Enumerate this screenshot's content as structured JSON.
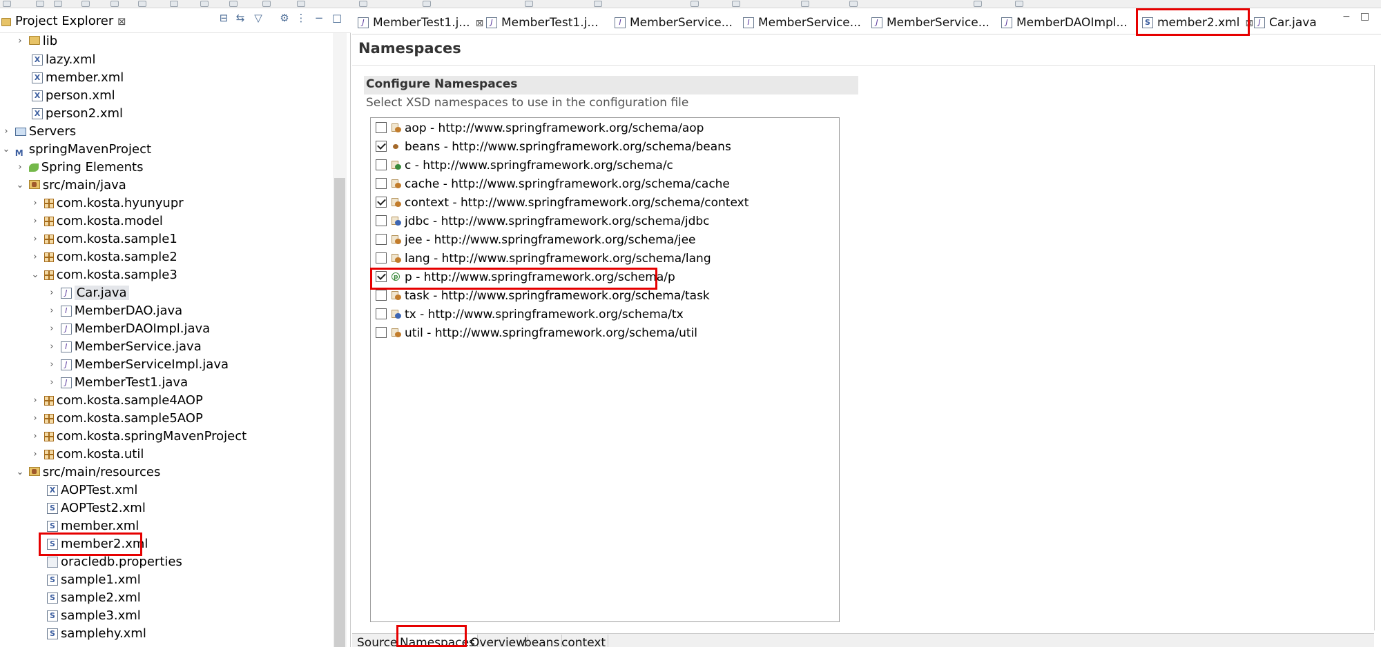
{
  "project_explorer": {
    "title": "Project Explorer",
    "close": "⊠",
    "tree": [
      {
        "label": "lib",
        "icon": "folder-icon",
        "chevron": "›"
      },
      {
        "label": "lazy.xml",
        "icon": "xml-file-icon"
      },
      {
        "label": "member.xml",
        "icon": "xml-file-icon"
      },
      {
        "label": "person.xml",
        "icon": "xml-file-icon"
      },
      {
        "label": "person2.xml",
        "icon": "xml-file-icon"
      },
      {
        "label": "Servers",
        "icon": "servers-folder-icon",
        "chevron": "›"
      },
      {
        "label": "springMavenProject",
        "icon": "maven-project-icon",
        "chevron": "⌄"
      },
      {
        "label": "Spring Elements",
        "icon": "spring-leaf-icon",
        "chevron": "›"
      },
      {
        "label": "src/main/java",
        "icon": "source-folder-icon",
        "chevron": "⌄"
      },
      {
        "label": "com.kosta.hyunyupr",
        "icon": "package-icon",
        "chevron": "›"
      },
      {
        "label": "com.kosta.model",
        "icon": "package-icon",
        "chevron": "›"
      },
      {
        "label": "com.kosta.sample1",
        "icon": "package-icon",
        "chevron": "›"
      },
      {
        "label": "com.kosta.sample2",
        "icon": "package-icon",
        "chevron": "›"
      },
      {
        "label": "com.kosta.sample3",
        "icon": "package-icon",
        "chevron": "⌄"
      },
      {
        "label": "Car.java",
        "icon": "java-file-icon",
        "chevron": "›"
      },
      {
        "label": "MemberDAO.java",
        "icon": "java-interface-icon",
        "chevron": "›"
      },
      {
        "label": "MemberDAOImpl.java",
        "icon": "java-spring-bean-icon",
        "chevron": "›"
      },
      {
        "label": "MemberService.java",
        "icon": "java-interface-icon",
        "chevron": "›"
      },
      {
        "label": "MemberServiceImpl.java",
        "icon": "java-spring-bean-icon",
        "chevron": "›"
      },
      {
        "label": "MemberTest1.java",
        "icon": "java-file-icon",
        "chevron": "›"
      },
      {
        "label": "com.kosta.sample4AOP",
        "icon": "package-icon",
        "chevron": "›"
      },
      {
        "label": "com.kosta.sample5AOP",
        "icon": "package-icon",
        "chevron": "›"
      },
      {
        "label": "com.kosta.springMavenProject",
        "icon": "package-icon",
        "chevron": "›"
      },
      {
        "label": "com.kosta.util",
        "icon": "package-icon",
        "chevron": "›"
      },
      {
        "label": "src/main/resources",
        "icon": "source-folder-icon",
        "chevron": "⌄"
      },
      {
        "label": "AOPTest.xml",
        "icon": "xml-file-icon"
      },
      {
        "label": "AOPTest2.xml",
        "icon": "spring-xml-icon"
      },
      {
        "label": "member.xml",
        "icon": "spring-xml-icon"
      },
      {
        "label": "member2.xml",
        "icon": "spring-xml-icon"
      },
      {
        "label": "oracledb.properties",
        "icon": "properties-file-icon"
      },
      {
        "label": "sample1.xml",
        "icon": "spring-xml-icon"
      },
      {
        "label": "sample2.xml",
        "icon": "spring-xml-icon"
      },
      {
        "label": "sample3.xml",
        "icon": "spring-xml-icon"
      },
      {
        "label": "samplehy.xml",
        "icon": "spring-xml-icon"
      }
    ]
  },
  "editor_tabs": [
    {
      "label": "MemberTest1.j...",
      "close": "⊠"
    },
    {
      "label": "MemberTest1.j..."
    },
    {
      "label": "MemberService..."
    },
    {
      "label": "MemberService..."
    },
    {
      "label": "MemberService..."
    },
    {
      "label": "MemberDAOImpl..."
    },
    {
      "label": "member2.xml",
      "close": "⊠"
    },
    {
      "label": "Car.java"
    }
  ],
  "namespaces_page": {
    "title": "Namespaces",
    "section_title": "Configure Namespaces",
    "section_description": "Select XSD namespaces to use in the configuration file",
    "namespaces": [
      {
        "label": "aop - http://www.springframework.org/schema/aop",
        "checked": false
      },
      {
        "label": "beans - http://www.springframework.org/schema/beans",
        "checked": true
      },
      {
        "label": "c - http://www.springframework.org/schema/c",
        "checked": false
      },
      {
        "label": "cache - http://www.springframework.org/schema/cache",
        "checked": false
      },
      {
        "label": "context - http://www.springframework.org/schema/context",
        "checked": true
      },
      {
        "label": "jdbc - http://www.springframework.org/schema/jdbc",
        "checked": false
      },
      {
        "label": "jee - http://www.springframework.org/schema/jee",
        "checked": false
      },
      {
        "label": "lang - http://www.springframework.org/schema/lang",
        "checked": false
      },
      {
        "label": "p - http://www.springframework.org/schema/p",
        "checked": true
      },
      {
        "label": "task - http://www.springframework.org/schema/task",
        "checked": false
      },
      {
        "label": "tx - http://www.springframework.org/schema/tx",
        "checked": false
      },
      {
        "label": "util - http://www.springframework.org/schema/util",
        "checked": false
      }
    ]
  },
  "page_tabs": [
    {
      "label": "Source"
    },
    {
      "label": "Namespaces"
    },
    {
      "label": "Overview"
    },
    {
      "label": "beans"
    },
    {
      "label": "context"
    }
  ],
  "colors": {
    "highlight": "#e60000",
    "selection": "#e4e6ea",
    "section_header": "#e9e9e9"
  }
}
